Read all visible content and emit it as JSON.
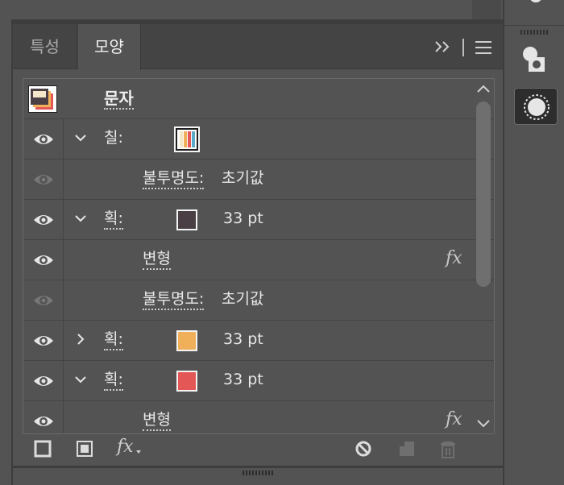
{
  "tabs": [
    {
      "label": "특성",
      "active": false
    },
    {
      "label": "모양",
      "active": true
    }
  ],
  "header": {
    "title": "문자"
  },
  "rows": [
    {
      "kind": "fill",
      "label": "칠:",
      "visible": true,
      "expanded": true,
      "swatch": "gradient-stripes"
    },
    {
      "kind": "opacity",
      "label": "불투명도:",
      "value": "초기값",
      "visible": false
    },
    {
      "kind": "stroke",
      "label": "획:",
      "value": "33 pt",
      "visible": true,
      "expanded": true,
      "color": "#4a3f44"
    },
    {
      "kind": "effect",
      "label": "변형",
      "visible": true,
      "fx": "fx"
    },
    {
      "kind": "opacity",
      "label": "불투명도:",
      "value": "초기값",
      "visible": false
    },
    {
      "kind": "stroke",
      "label": "획:",
      "value": "33 pt",
      "visible": true,
      "expanded": false,
      "color": "#f0b05a"
    },
    {
      "kind": "stroke",
      "label": "획:",
      "value": "33 pt",
      "visible": true,
      "expanded": true,
      "color": "#e45757"
    },
    {
      "kind": "effect",
      "label": "변형",
      "visible": true,
      "fx": "fx"
    }
  ],
  "footer": {
    "fx_label": "fx"
  },
  "colors": {
    "panel": "#535353",
    "tabbar": "#444444",
    "border": "#3d3d3d"
  }
}
